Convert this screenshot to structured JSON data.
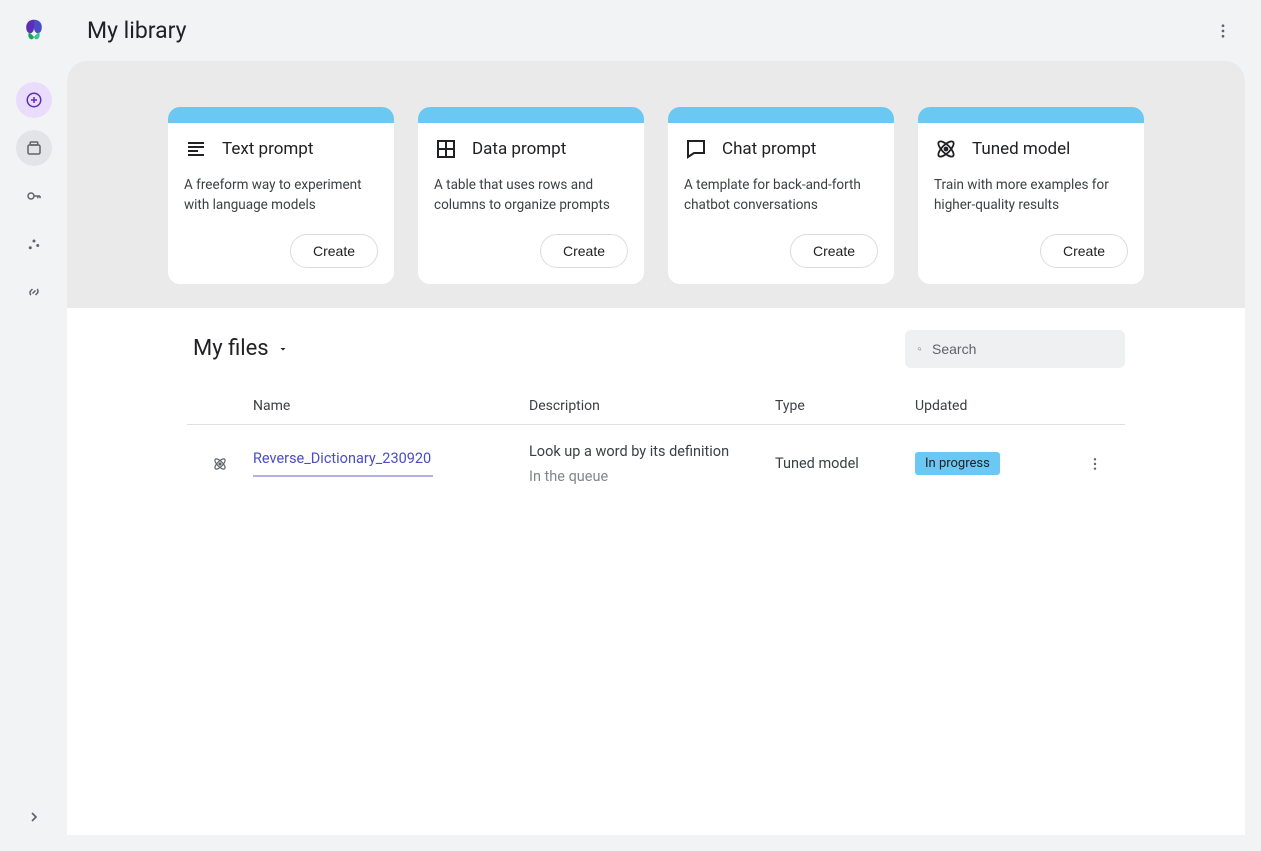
{
  "header": {
    "title": "My library"
  },
  "cards": [
    {
      "title": "Text prompt",
      "description": "A freeform way to experiment with language models",
      "button": "Create",
      "icon": "subject-icon",
      "bar_color": "#6bc8f2"
    },
    {
      "title": "Data prompt",
      "description": "A table that uses rows and columns to organize prompts",
      "button": "Create",
      "icon": "grid-icon",
      "bar_color": "#6bc8f2"
    },
    {
      "title": "Chat prompt",
      "description": "A template for back-and-forth chatbot conversations",
      "button": "Create",
      "icon": "chat-icon",
      "bar_color": "#6bc8f2"
    },
    {
      "title": "Tuned model",
      "description": "Train with more examples for higher-quality results",
      "button": "Create",
      "icon": "atom-icon",
      "bar_color": "#6bc8f2"
    }
  ],
  "files": {
    "section_label": "My files",
    "search_placeholder": "Search",
    "columns": {
      "name": "Name",
      "description": "Description",
      "type": "Type",
      "updated": "Updated"
    },
    "rows": [
      {
        "icon": "atom-icon",
        "name": "Reverse_Dictionary_230920",
        "description": "Look up a word by its definition",
        "description_sub": "In the queue",
        "type": "Tuned model",
        "updated_badge": "In progress"
      }
    ]
  },
  "colors": {
    "accent_blue": "#6bc8f2",
    "link_purple": "#4a4dc4",
    "sidebar_purple_bg": "#e9dcfd",
    "page_bg": "#f1f3f4"
  }
}
